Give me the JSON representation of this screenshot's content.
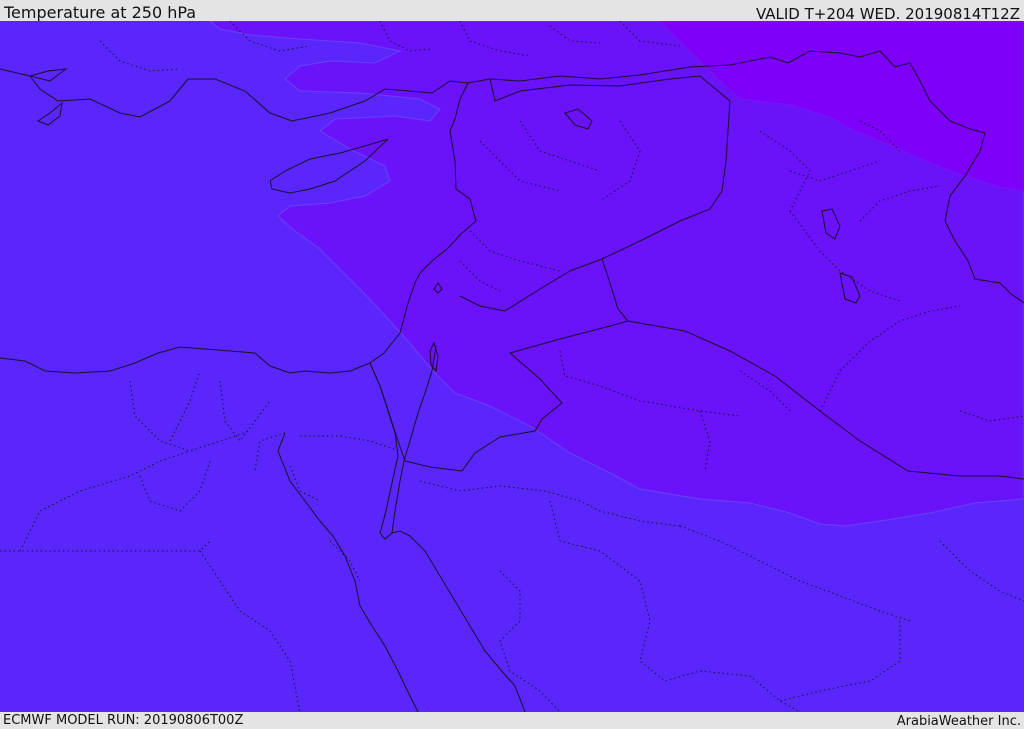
{
  "header": {
    "title": "Temperature at 250 hPa",
    "valid": "VALID T+204 WED. 20190814T12Z"
  },
  "footer": {
    "model_run": "ECMWF MODEL RUN: 20190806T00Z",
    "credit": "ArabiaWeather Inc."
  },
  "map": {
    "colors": {
      "base_band": "#5a26fc",
      "mid_band": "#6a12fa",
      "warm_band": "#7d00f8",
      "band_edge": "#6a40f6",
      "coastline": "#1a1030",
      "border": "#1a1030"
    }
  }
}
